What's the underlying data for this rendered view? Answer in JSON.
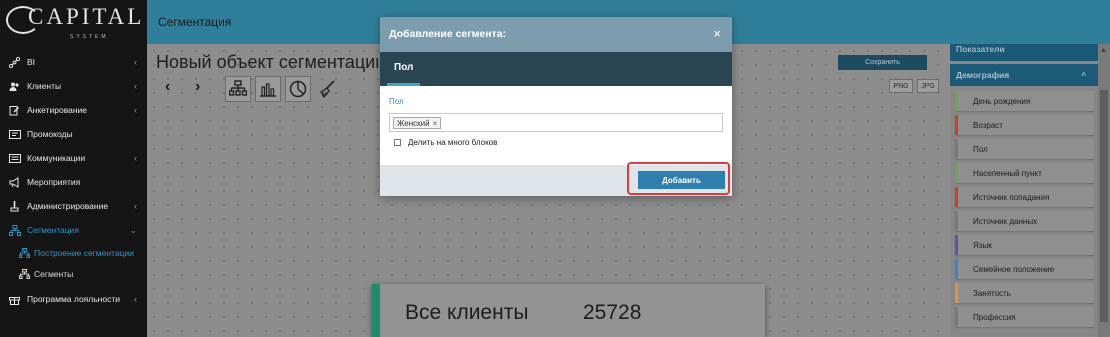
{
  "brand": {
    "logo_text": "CAPITAL",
    "logo_sub": "SYSTEM"
  },
  "sidebar": {
    "items": [
      {
        "label": "BI",
        "icon": "share-icon",
        "chevron": "‹"
      },
      {
        "label": "Клиенты",
        "icon": "users-icon",
        "chevron": "‹"
      },
      {
        "label": "Анкетирование",
        "icon": "edit-icon",
        "chevron": "‹"
      },
      {
        "label": "Промокоды",
        "icon": "ticket-icon"
      },
      {
        "label": "Коммуникации",
        "icon": "list-icon",
        "chevron": "‹"
      },
      {
        "label": "Мероприятия",
        "icon": "bullhorn-icon"
      },
      {
        "label": "Администрирование",
        "icon": "wrench-icon",
        "chevron": "‹"
      },
      {
        "label": "Сегментация",
        "icon": "sitemap-icon",
        "chevron": "⌄"
      },
      {
        "label": "Программа лояльности",
        "icon": "gift-icon",
        "chevron": "‹"
      }
    ],
    "subitems": [
      {
        "label": "Построение сегментации"
      },
      {
        "label": "Сегменты"
      }
    ]
  },
  "header": {
    "title": "Сегментация"
  },
  "main": {
    "page_title": "Новый объект сегментации",
    "save_label": "Сохранить",
    "png_label": "PNG",
    "jpg_label": "JPG",
    "prev_arrow": "‹",
    "next_arrow": "›",
    "card": {
      "label": "Все клиенты",
      "count": "25728"
    }
  },
  "right_panel": {
    "header": "Показатели",
    "group": "Демография",
    "group_caret": "^",
    "items": [
      {
        "label": "День рождения",
        "color": "#6aa84f"
      },
      {
        "label": "Возраст",
        "color": "#cc4125"
      },
      {
        "label": "Пол",
        "color": "#7a7a7a"
      },
      {
        "label": "Населенный пункт",
        "color": "#6aa84f"
      },
      {
        "label": "Источник попадания",
        "color": "#cc4125"
      },
      {
        "label": "Источник данных",
        "color": "#7a7a7a"
      },
      {
        "label": "Язык",
        "color": "#674ea7"
      },
      {
        "label": "Семейное положение",
        "color": "#3d85c6"
      },
      {
        "label": "Занятость",
        "color": "#e69138"
      },
      {
        "label": "Профессия",
        "color": "#7a7a7a"
      }
    ]
  },
  "modal": {
    "title": "Добавление сегмента:",
    "close": "×",
    "tab": "Пол",
    "field_label": "Пол",
    "chip": "Женский",
    "chip_remove": "×",
    "checkbox_label": "Делить на много блоков",
    "add_label": "Добавить"
  },
  "colors": {
    "header": "#2f7f9a",
    "sidebar": "#151515",
    "accent": "#2f97c7",
    "modal_header": "#7d9dae",
    "modal_tabs": "#2a4652",
    "add_button": "#2f7fae",
    "highlight": "#e0383f"
  }
}
